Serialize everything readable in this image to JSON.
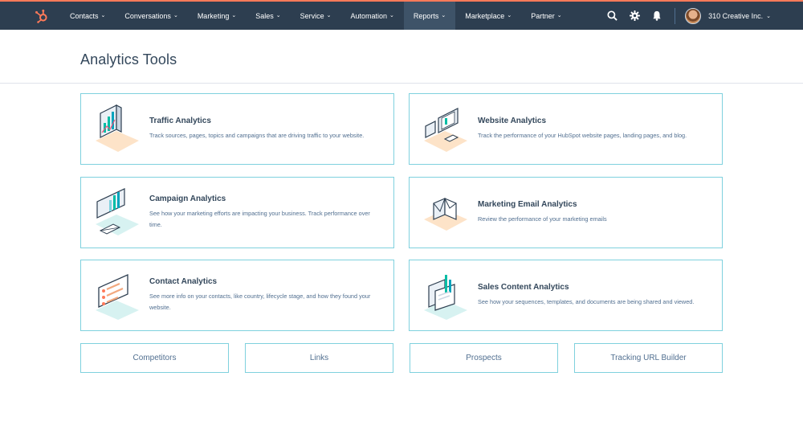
{
  "nav": {
    "items": [
      {
        "label": "Contacts",
        "active": false
      },
      {
        "label": "Conversations",
        "active": false
      },
      {
        "label": "Marketing",
        "active": false
      },
      {
        "label": "Sales",
        "active": false
      },
      {
        "label": "Service",
        "active": false
      },
      {
        "label": "Automation",
        "active": false
      },
      {
        "label": "Reports",
        "active": true
      },
      {
        "label": "Marketplace",
        "active": false
      },
      {
        "label": "Partner",
        "active": false
      }
    ],
    "chevron": "⌄",
    "account_name": "310 Creative Inc.",
    "icons": [
      "hubspot-logo-icon",
      "search-icon",
      "gear-icon",
      "bell-icon"
    ],
    "colors": {
      "navbar": "#2d3e50",
      "accent": "#ff7a59",
      "card_border": "#7fd1de"
    }
  },
  "page": {
    "title": "Analytics Tools"
  },
  "cards": [
    {
      "title": "Traffic Analytics",
      "desc": "Track sources, pages, topics and campaigns that are driving traffic to your website."
    },
    {
      "title": "Website Analytics",
      "desc": "Track the performance of your HubSpot website pages, landing pages, and blog."
    },
    {
      "title": "Campaign Analytics",
      "desc": "See how your marketing efforts are impacting your business. Track performance over time."
    },
    {
      "title": "Marketing Email Analytics",
      "desc": "Review the performance of your marketing emails"
    },
    {
      "title": "Contact Analytics",
      "desc": "See more info on your contacts, like country, lifecycle stage, and how they found your website."
    },
    {
      "title": "Sales Content Analytics",
      "desc": "See how your sequences, templates, and documents are being shared and viewed."
    }
  ],
  "buttons": [
    {
      "label": "Competitors"
    },
    {
      "label": "Links"
    },
    {
      "label": "Prospects"
    },
    {
      "label": "Tracking URL Builder"
    }
  ]
}
